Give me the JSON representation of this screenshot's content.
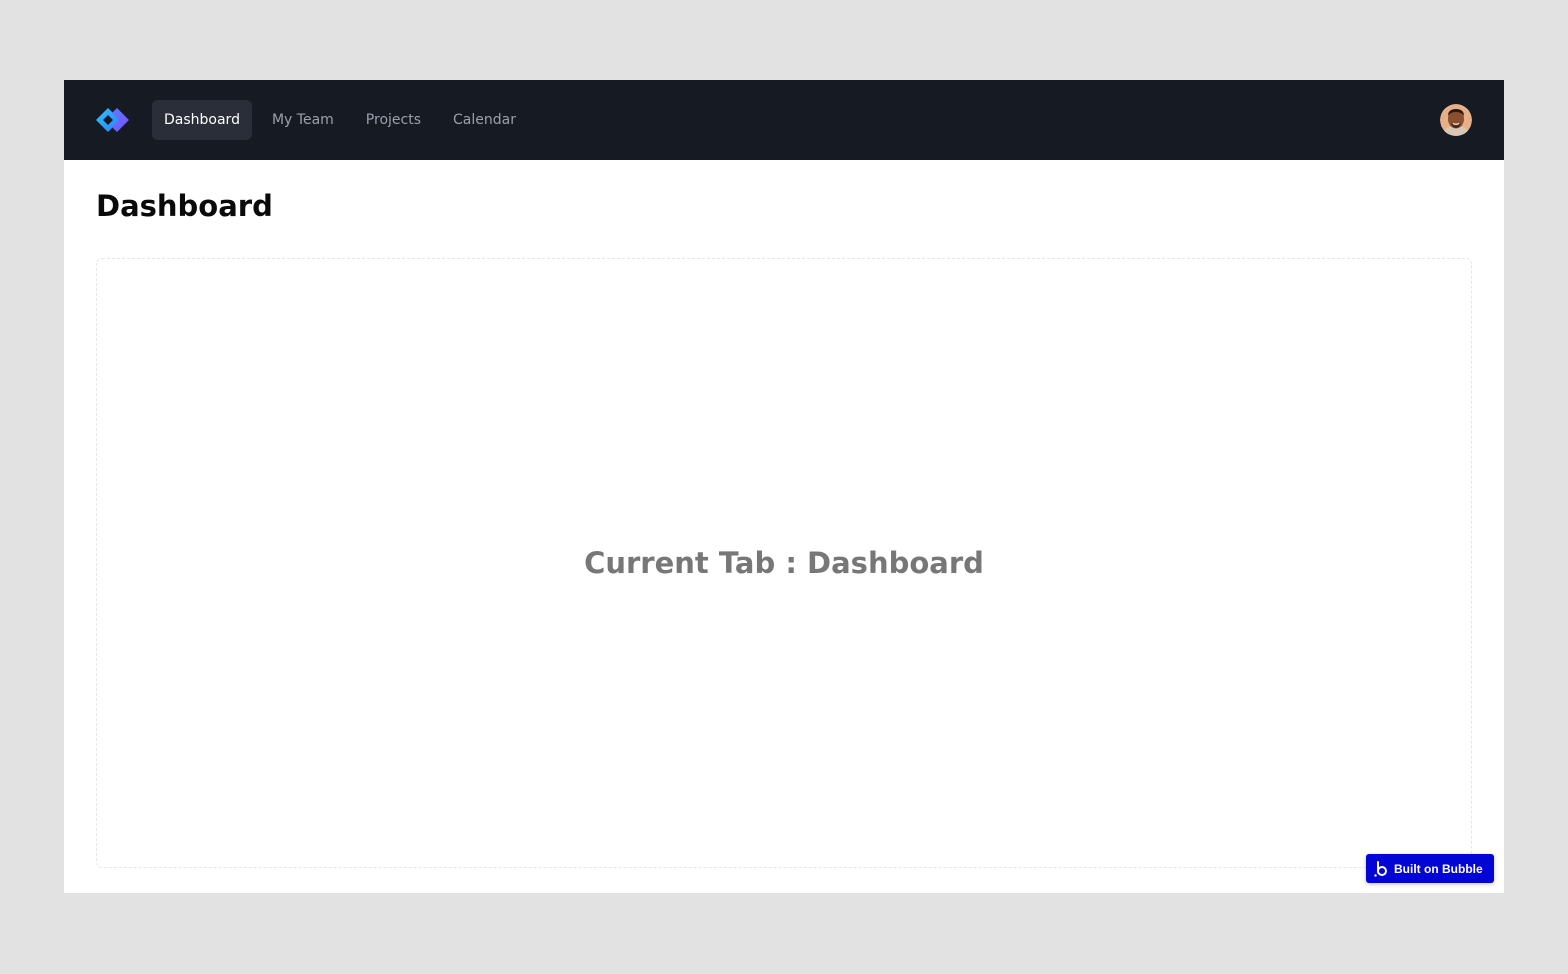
{
  "nav": {
    "tabs": [
      {
        "label": "Dashboard",
        "active": true
      },
      {
        "label": "My Team",
        "active": false
      },
      {
        "label": "Projects",
        "active": false
      },
      {
        "label": "Calendar",
        "active": false
      }
    ],
    "logo_icon": "diamond-logo-icon",
    "avatar_icon": "user-avatar"
  },
  "main": {
    "page_title": "Dashboard",
    "current_tab_text": "Current Tab : Dashboard"
  },
  "badge": {
    "label": "Built on Bubble",
    "icon": "bubble-logo-icon"
  },
  "colors": {
    "navbar_bg": "#161a23",
    "active_tab_bg": "#2a2e38",
    "badge_bg": "#0205d3",
    "page_bg": "#e2e2e2"
  }
}
